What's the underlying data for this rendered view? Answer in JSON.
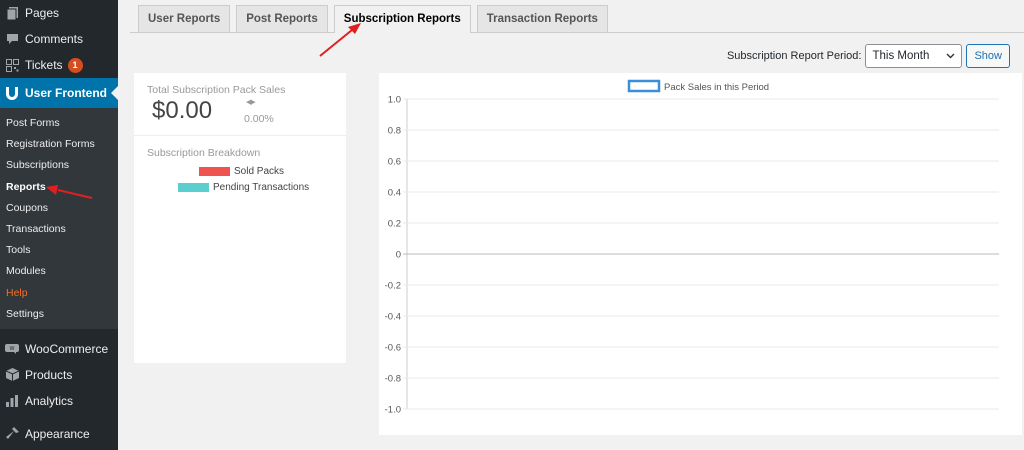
{
  "sidebar": {
    "top_items": [
      {
        "label": "Pages",
        "icon": "pages-icon"
      },
      {
        "label": "Comments",
        "icon": "comments-icon"
      },
      {
        "label": "Tickets",
        "icon": "tickets-icon",
        "badge": "1"
      },
      {
        "label": "User Frontend",
        "icon": "user-frontend-icon",
        "current": true
      }
    ],
    "submenu": [
      {
        "label": "Post Forms"
      },
      {
        "label": "Registration Forms"
      },
      {
        "label": "Subscriptions"
      },
      {
        "label": "Reports",
        "current": true
      },
      {
        "label": "Coupons"
      },
      {
        "label": "Transactions"
      },
      {
        "label": "Tools"
      },
      {
        "label": "Modules"
      },
      {
        "label": "Help",
        "highlight": true
      },
      {
        "label": "Settings"
      }
    ],
    "bottom_items": [
      {
        "label": "WooCommerce",
        "icon": "woocommerce-icon"
      },
      {
        "label": "Products",
        "icon": "products-icon"
      },
      {
        "label": "Analytics",
        "icon": "analytics-icon"
      },
      {
        "label": "Appearance",
        "icon": "appearance-icon"
      }
    ]
  },
  "tabs": [
    {
      "label": "User Reports"
    },
    {
      "label": "Post Reports"
    },
    {
      "label": "Subscription Reports",
      "active": true
    },
    {
      "label": "Transaction Reports"
    }
  ],
  "period": {
    "label": "Subscription Report Period:",
    "selected": "This Month",
    "show_button": "Show"
  },
  "summary": {
    "total_label": "Total Subscription Pack Sales",
    "total_value": "$0.00",
    "change_percent": "0.00%",
    "breakdown_label": "Subscription Breakdown",
    "legend": [
      {
        "label": "Sold Packs",
        "color": "#ef5350"
      },
      {
        "label": "Pending Transactions",
        "color": "#5bcfcf"
      }
    ]
  },
  "chart_data": {
    "type": "line",
    "series": [
      {
        "name": "Pack Sales in this Period",
        "values": [],
        "color": "#3b8fd9"
      }
    ],
    "y_ticks": [
      "1.0",
      "0.8",
      "0.6",
      "0.4",
      "0.2",
      "0",
      "-0.2",
      "-0.4",
      "-0.6",
      "-0.8",
      "-1.0"
    ],
    "ylim": [
      -1.0,
      1.0
    ],
    "grid": true,
    "legend_position": "top"
  },
  "colors": {
    "sidebar_bg": "#23282d",
    "accent": "#0073aa",
    "annotation_arrow": "#e02020"
  }
}
